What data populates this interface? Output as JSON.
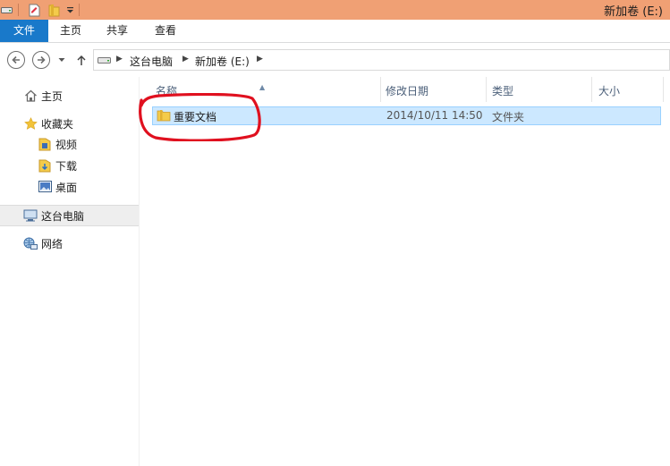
{
  "window": {
    "title": "新加卷 (E:)"
  },
  "ribbon": {
    "tabs": [
      {
        "label": "文件",
        "active": true
      },
      {
        "label": "主页"
      },
      {
        "label": "共享"
      },
      {
        "label": "查看"
      }
    ]
  },
  "address": {
    "crumbs": [
      "这台电脑",
      "新加卷 (E:)"
    ]
  },
  "nav": {
    "items": [
      {
        "label": "主页",
        "icon": "home-icon"
      },
      {
        "label": "收藏夹",
        "icon": "star-icon"
      },
      {
        "label": "视频",
        "icon": "video-folder-icon"
      },
      {
        "label": "下载",
        "icon": "download-folder-icon"
      },
      {
        "label": "桌面",
        "icon": "desktop-icon"
      },
      {
        "label": "这台电脑",
        "icon": "computer-icon",
        "selected": true
      },
      {
        "label": "网络",
        "icon": "network-icon"
      }
    ]
  },
  "filelist": {
    "columns": [
      "名称",
      "修改日期",
      "类型",
      "大小"
    ],
    "rows": [
      {
        "name": "重要文档",
        "modified": "2014/10/11 14:50",
        "type": "文件夹",
        "size": "",
        "icon": "folder-icon",
        "selected": true
      }
    ]
  },
  "colors": {
    "titlebar": "#f0a074",
    "file_tab": "#1979ca",
    "selection": "#cce8ff",
    "annotation": "#e0101f"
  }
}
